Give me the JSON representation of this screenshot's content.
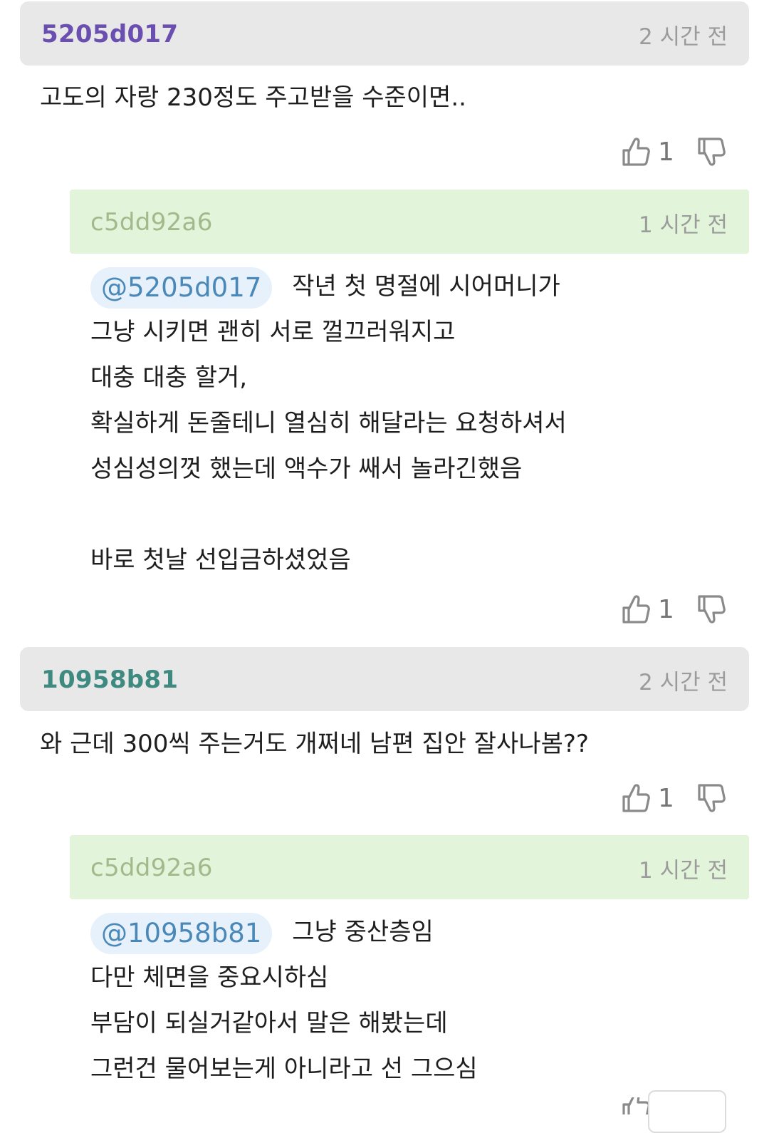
{
  "comments": [
    {
      "author": "5205d017",
      "author_color": "#6a4fb0",
      "time": "2 시간 전",
      "text": "고도의 자랑 230정도 주고받을 수준이면..",
      "likes": "1",
      "reply": {
        "author": "c5dd92a6",
        "author_color": "#a3b98b",
        "time": "1 시간 전",
        "mention": "@5205d017",
        "lines": [
          "작년 첫 명절에 시어머니가",
          "그냥 시키면 괜히 서로 껄끄러워지고",
          "대충 대충 할거,",
          "확실하게 돈줄테니 열심히 해달라는 요청하셔서",
          "성심성의껏 했는데 액수가 쌔서 놀라긴했음",
          "",
          "바로 첫날 선입금하셨었음"
        ],
        "likes": "1"
      }
    },
    {
      "author": "10958b81",
      "author_color": "#3e8a80",
      "time": "2 시간 전",
      "text": "와 근데 300씩 주는거도 개쩌네 남편 집안 잘사나봄??",
      "likes": "1",
      "reply": {
        "author": "c5dd92a6",
        "author_color": "#a3b98b",
        "time": "1 시간 전",
        "mention": "@10958b81",
        "lines": [
          "그냥 중산층임",
          "다만 체면을 중요시하심",
          "부담이 되실거같아서 말은 해봤는데",
          "그런건 물어보는게 아니라고 선 그으심"
        ]
      }
    }
  ],
  "icons": {
    "like": "thumbs-up-icon",
    "dislike": "thumbs-down-icon"
  }
}
